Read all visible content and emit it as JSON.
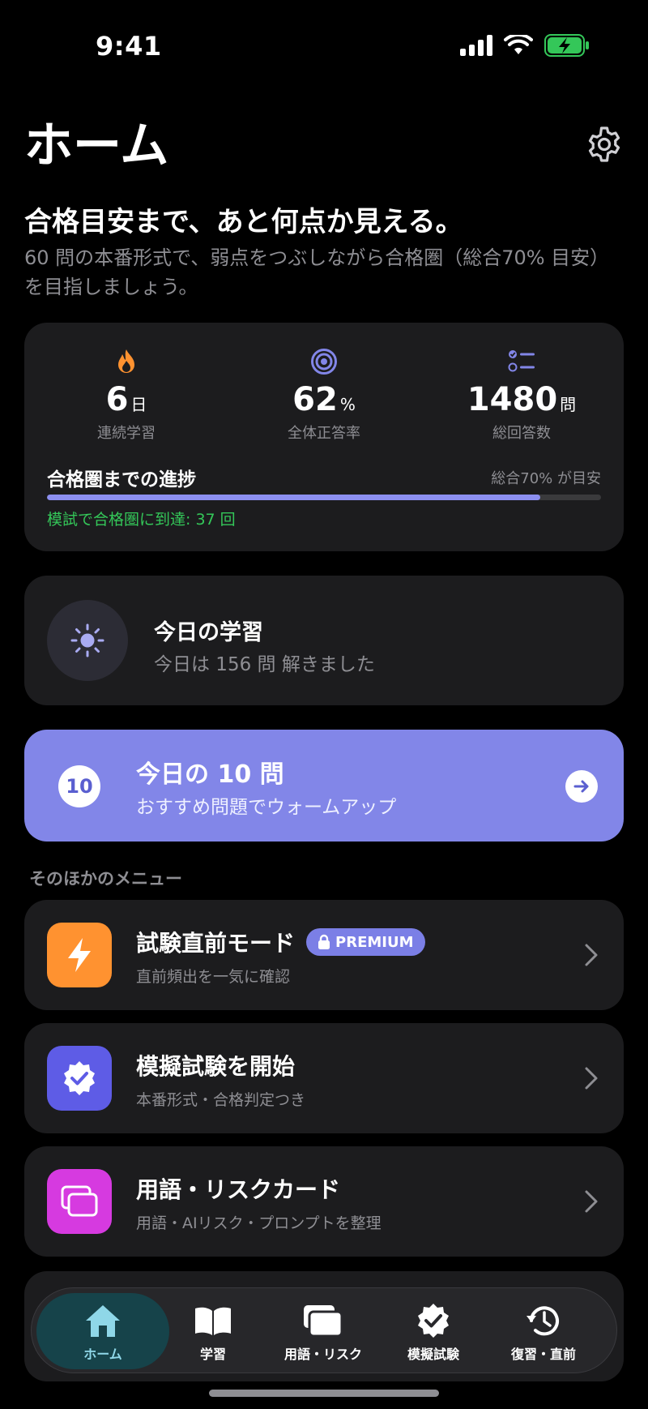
{
  "status_bar": {
    "time": "9:41"
  },
  "header": {
    "title": "ホーム"
  },
  "intro": {
    "headline": "合格目安まで、あと何点か見える。",
    "subtext": "60 問の本番形式で、弱点をつぶしながら合格圏（総合70% 目安）を目指しましょう。"
  },
  "stats": [
    {
      "value": "6",
      "unit": "日",
      "label": "連続学習",
      "icon": "flame-icon"
    },
    {
      "value": "62",
      "unit": "%",
      "label": "全体正答率",
      "icon": "target-icon"
    },
    {
      "value": "1480",
      "unit": "問",
      "label": "総回答数",
      "icon": "checklist-icon"
    }
  ],
  "progress": {
    "title": "合格圏までの進捗",
    "target": "総合70% が目安",
    "fraction": 0.89,
    "note": "模試で合格圏に到達: 37 回"
  },
  "today": {
    "title": "今日の学習",
    "subtitle": "今日は 156 問 解きました"
  },
  "daily_ten": {
    "badge": "10",
    "title": "今日の 10 問",
    "subtitle": "おすすめ問題でウォームアップ"
  },
  "menu": {
    "section_label": "そのほかのメニュー",
    "items": [
      {
        "title": "試験直前モード",
        "subtitle": "直前頻出を一気に確認",
        "badge": "PREMIUM",
        "icon": "bolt-icon",
        "color": "#ff9230"
      },
      {
        "title": "模擬試験を開始",
        "subtitle": "本番形式・合格判定つき",
        "icon": "verified-badge-icon",
        "color": "#5e5ce6"
      },
      {
        "title": "用語・リスクカード",
        "subtitle": "用語・AIリスク・プロンプトを整理",
        "icon": "cards-icon",
        "color": "#d63ae0"
      }
    ]
  },
  "tabs": [
    {
      "label": "ホーム",
      "icon": "home-icon",
      "active": true
    },
    {
      "label": "学習",
      "icon": "book-icon"
    },
    {
      "label": "用語・リスク",
      "icon": "cards-icon"
    },
    {
      "label": "模擬試験",
      "icon": "verified-badge-icon"
    },
    {
      "label": "復習・直前",
      "icon": "history-icon"
    }
  ],
  "colors": {
    "accent": "#8286e8",
    "card_bg": "#1c1c1e",
    "success": "#34c759",
    "secondary_text": "#8e8e93",
    "tab_active": "#8fd7e8"
  }
}
